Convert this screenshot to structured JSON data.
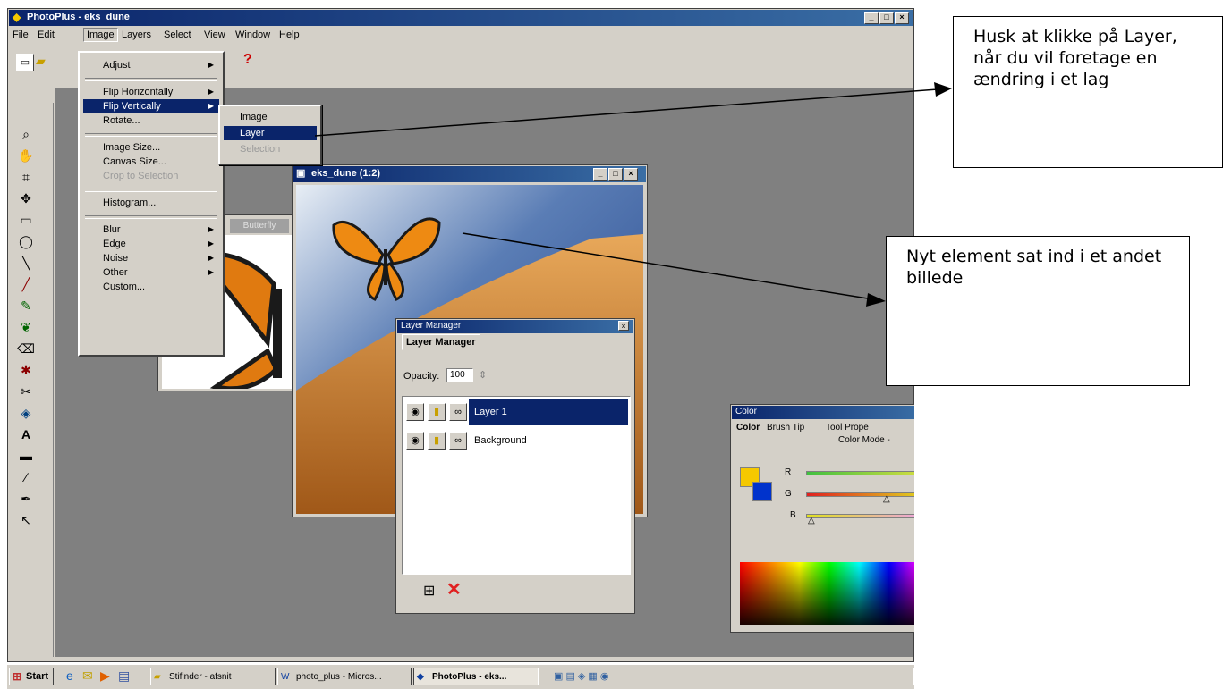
{
  "app": {
    "title": "PhotoPlus - eks_dune",
    "menubar": [
      "File",
      "Edit",
      "Image",
      "Layers",
      "Select",
      "View",
      "Window",
      "Help"
    ]
  },
  "image_menu": {
    "items": [
      "Adjust",
      "Flip Horizontally",
      "Flip Vertically",
      "Rotate...",
      "Image Size...",
      "Canvas Size...",
      "Crop to Selection",
      "Histogram...",
      "Blur",
      "Edge",
      "Noise",
      "Other",
      "Custom..."
    ]
  },
  "flip_submenu": {
    "items": [
      "Image",
      "Layer",
      "Selection"
    ]
  },
  "background_doc": {
    "button": "Butterfly"
  },
  "doc_window": {
    "title": "eks_dune (1:2)"
  },
  "layer_manager": {
    "title": "Layer Manager",
    "tab": "Layer Manager",
    "opacity_label": "Opacity:",
    "opacity_value": "100",
    "layers": [
      "Layer 1",
      "Background"
    ]
  },
  "color_panel": {
    "title": "Color",
    "tabs": [
      "Color",
      "Brush Tip",
      "Tool Prope"
    ],
    "mode_label": "Color Mode -",
    "channels": [
      "R",
      "G",
      "B"
    ]
  },
  "taskbar": {
    "start": "Start",
    "tasks": [
      "Stifinder - afsnit",
      "photo_plus - Micros...",
      "PhotoPlus - eks..."
    ]
  },
  "callouts": {
    "top": "Husk at klikke på Layer, når du vil foretage en ændring i et lag",
    "right": "Nyt element sat ind i et andet billede"
  },
  "colors": {
    "desktop": "#808080",
    "chrome": "#d4d0c8",
    "title_active": "#0a246a",
    "fg_color": "#f5c800",
    "bg_color": "#0033cc"
  }
}
